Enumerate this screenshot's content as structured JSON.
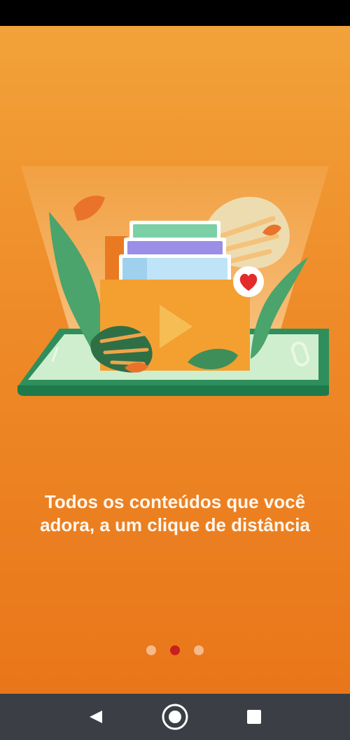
{
  "onboarding": {
    "headline": "Todos os conteúdos que você adora, a um clique de distância",
    "page_indicator": {
      "total": 3,
      "active_index": 1
    }
  },
  "navigation": {
    "back_icon": "back-triangle-icon",
    "home_icon": "home-circle-icon",
    "recents_icon": "recents-square-icon"
  },
  "colors": {
    "background_top": "#f2a23a",
    "background_bottom": "#e9761a",
    "text": "#fff7ef",
    "active_dot": "#c8201c",
    "inactive_dot": "#f7b98a",
    "nav_bar": "#3b3f45"
  }
}
